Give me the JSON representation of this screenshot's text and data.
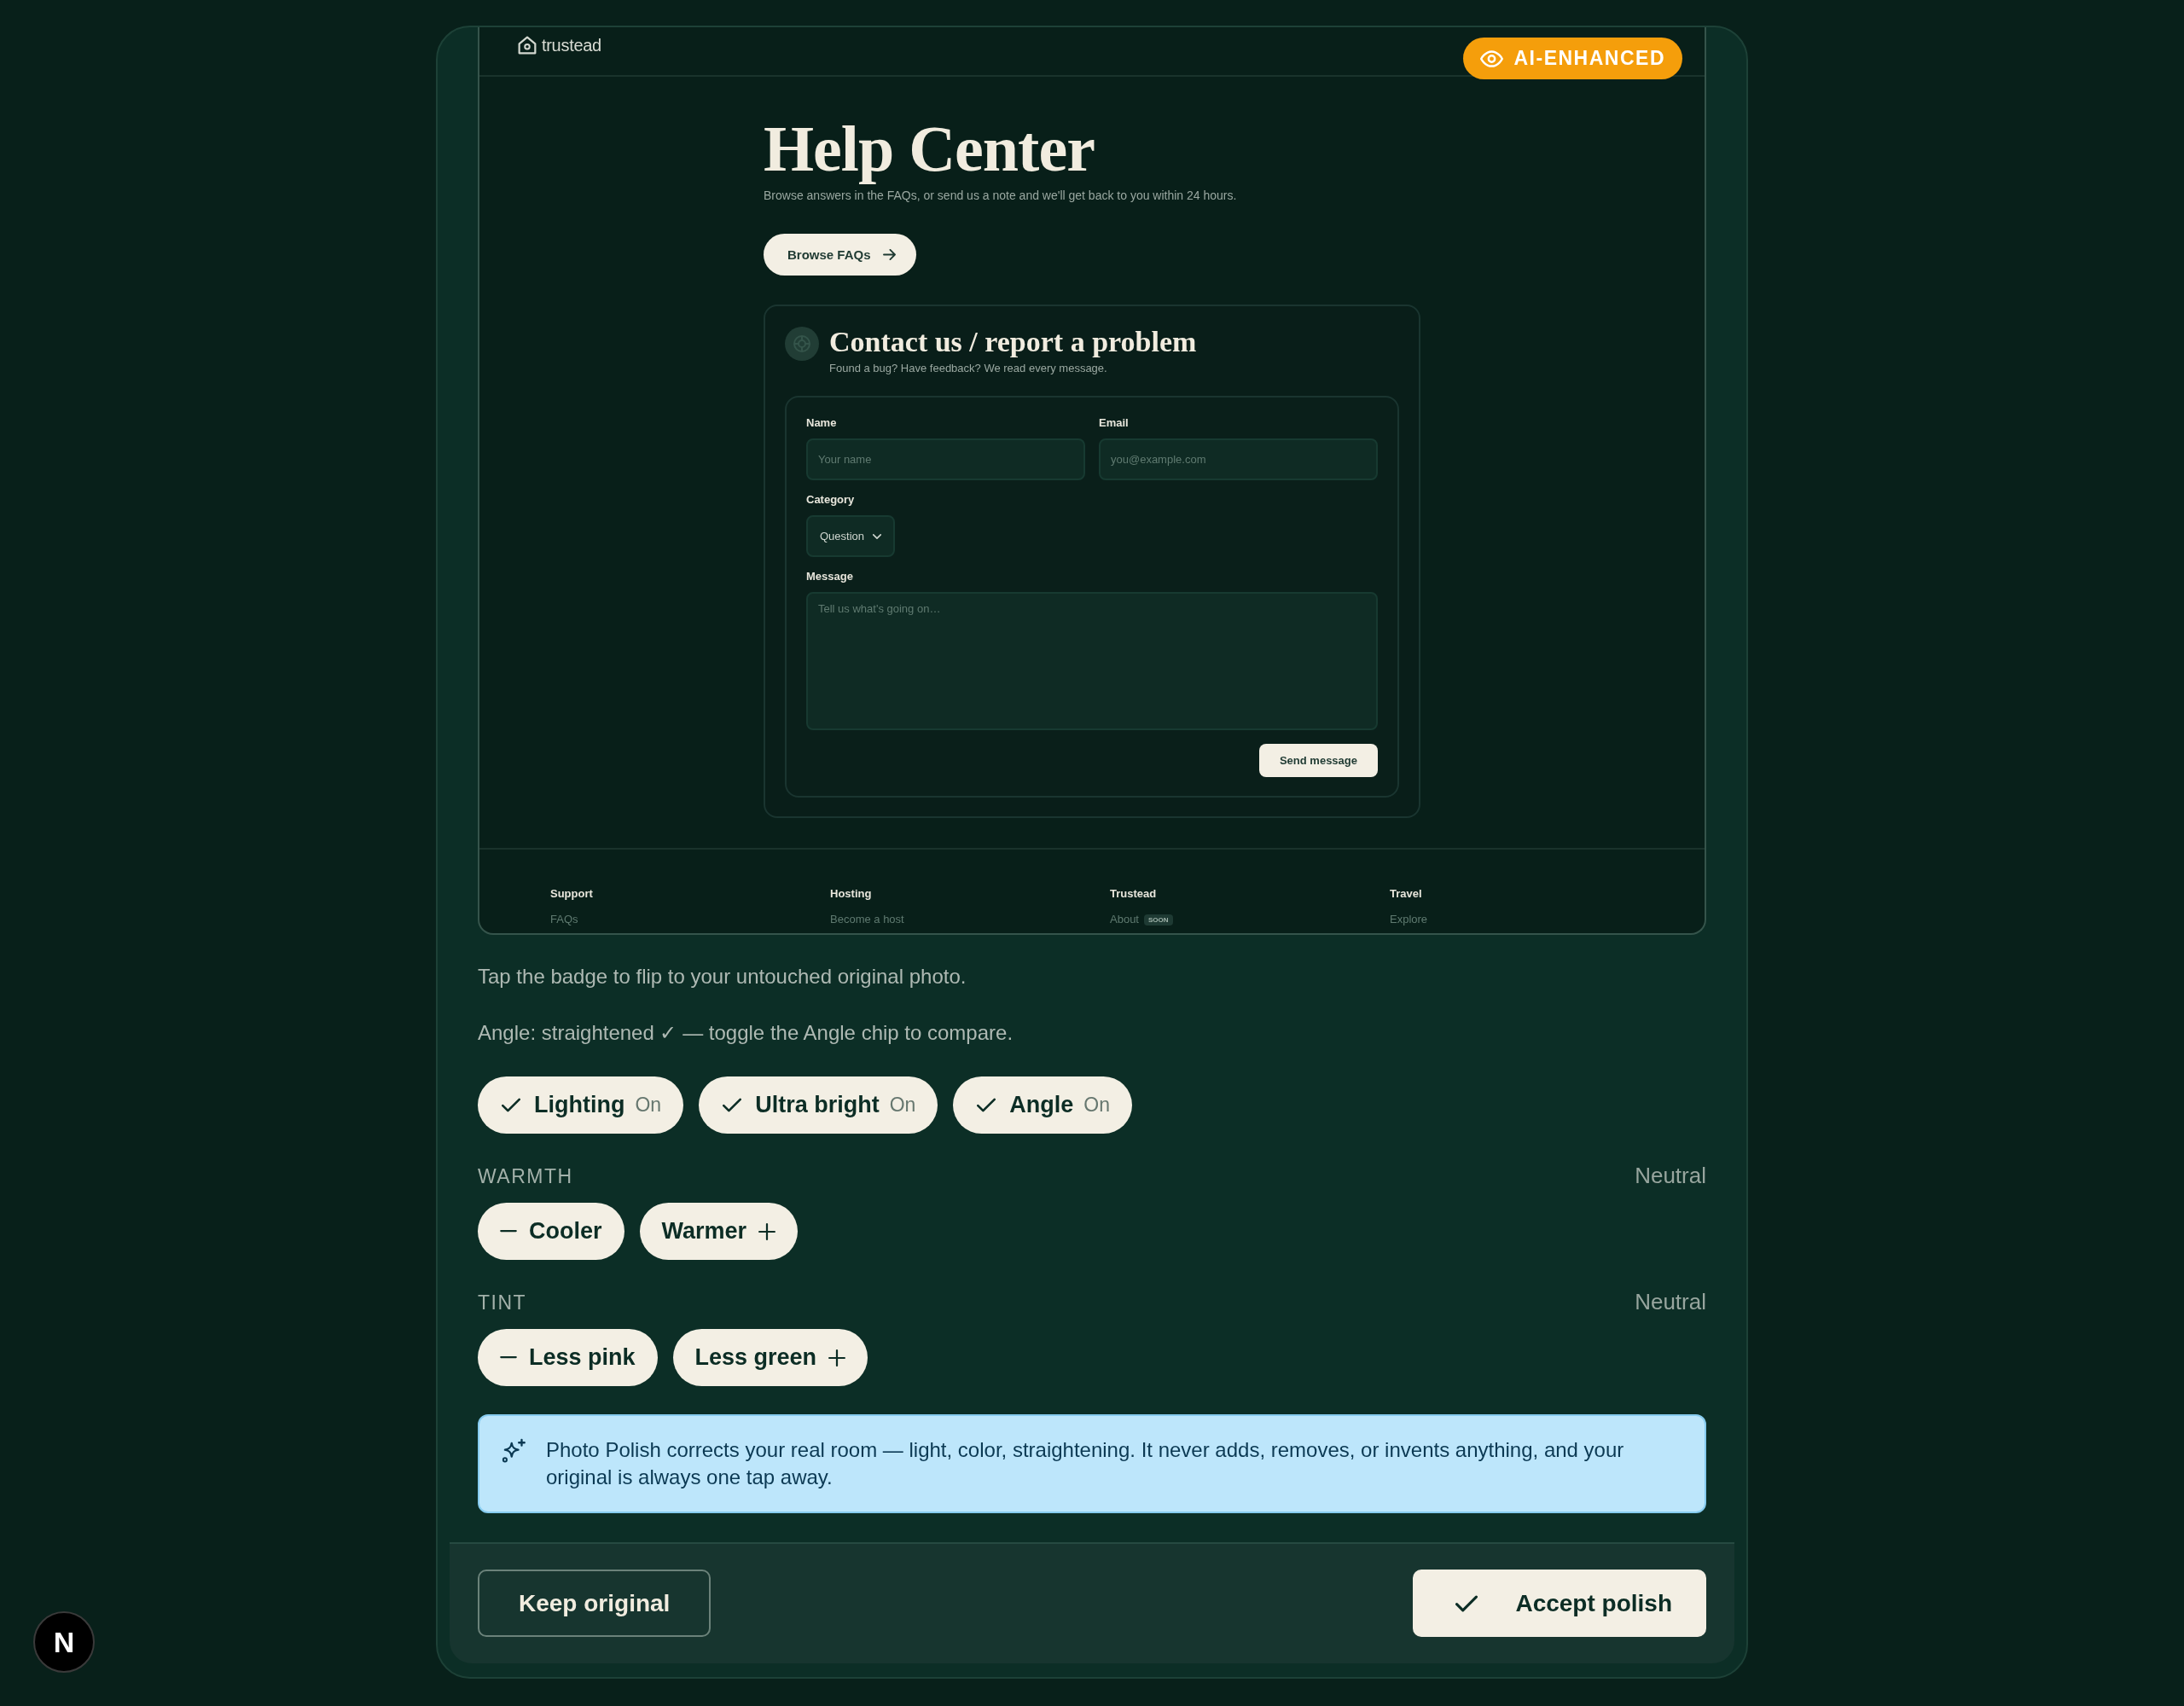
{
  "photo": {
    "logo": "trustead",
    "badge": "AI-ENHANCED",
    "title": "Help Center",
    "subtitle": "Browse answers in the FAQs, or send us a note and we'll get back to you within 24 hours.",
    "browse_button": "Browse FAQs",
    "contact": {
      "title": "Contact us / report a problem",
      "subtitle": "Found a bug? Have feedback? We read every message.",
      "fields": [
        {
          "kind": "input",
          "label": "Name",
          "placeholder": "Your name"
        },
        {
          "kind": "input",
          "label": "Email",
          "placeholder": "you@example.com"
        },
        {
          "kind": "select",
          "label": "Category",
          "value": "Question"
        },
        {
          "kind": "textarea",
          "label": "Message",
          "placeholder": "Tell us what's going on…"
        }
      ],
      "submit": "Send message"
    },
    "footer": [
      {
        "heading": "Support",
        "link": "FAQs"
      },
      {
        "heading": "Hosting",
        "link": "Become a host"
      },
      {
        "heading": "Trustead",
        "link": "About",
        "tag": "SOON"
      },
      {
        "heading": "Travel",
        "link": "Explore"
      }
    ]
  },
  "captions": [
    "Tap the badge to flip to your untouched original photo.",
    "Angle: straightened ✓ — toggle the Angle chip to compare."
  ],
  "toggles": [
    {
      "label": "Lighting",
      "status": "On",
      "checked": true
    },
    {
      "label": "Ultra bright",
      "status": "On",
      "checked": true
    },
    {
      "label": "Angle",
      "status": "On",
      "checked": true
    }
  ],
  "adjustments": [
    {
      "title": "WARMTH",
      "value": "Neutral",
      "buttons": [
        {
          "label": "Cooler",
          "kind": "minus"
        },
        {
          "label": "Warmer",
          "kind": "plus"
        }
      ]
    },
    {
      "title": "TINT",
      "value": "Neutral",
      "buttons": [
        {
          "label": "Less pink",
          "kind": "minus"
        },
        {
          "label": "Less green",
          "kind": "plus"
        }
      ]
    }
  ],
  "notice": "Photo Polish corrects your real room — light, color, straightening. It never adds, removes, or invents anything, and your original is always one tap away.",
  "actions": [
    {
      "label": "Keep original",
      "kind": "secondary"
    },
    {
      "label": "Accept polish",
      "kind": "primary"
    }
  ],
  "dev_badge": "N"
}
